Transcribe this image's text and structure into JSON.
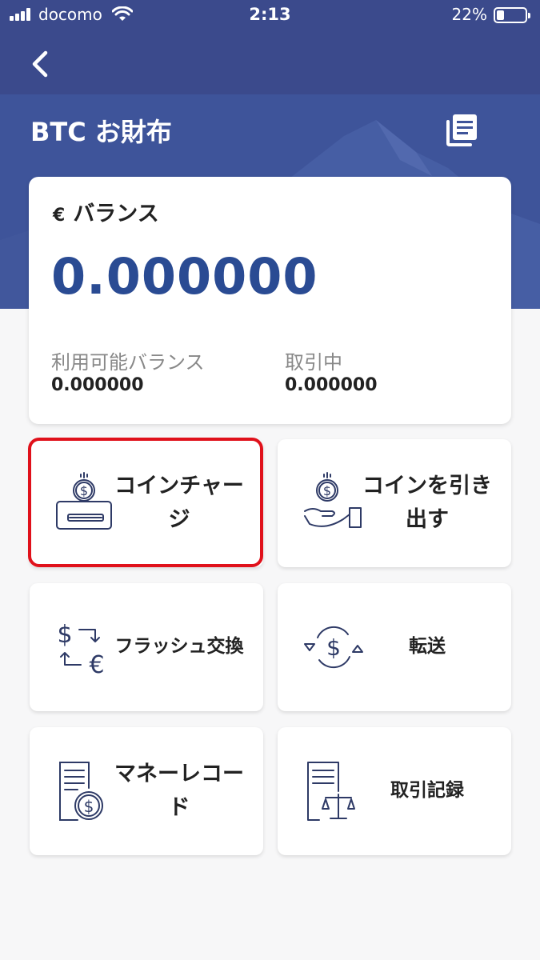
{
  "status_bar": {
    "carrier": "docomo",
    "time": "2:13",
    "battery": "22%",
    "battery_level": 0.22
  },
  "header": {
    "back_icon": "chevron-left-icon",
    "title": "BTC お財布",
    "records_icon": "document-list-icon",
    "background_color": "#3a4d8f"
  },
  "balance": {
    "currency_symbol": "€",
    "label": "バランス",
    "value": "0.000000",
    "available_label": "利用可能バランス",
    "available_value": "0.000000",
    "trading_label": "取引中",
    "trading_value": "0.000000",
    "value_color": "#2a4b93"
  },
  "actions": [
    {
      "label": "コインチャージ",
      "icon": "coin-charge-icon",
      "highlighted": true
    },
    {
      "label": "コインを引き出す",
      "icon": "coin-withdraw-icon",
      "highlighted": false
    },
    {
      "label": "フラッシュ交換",
      "icon": "flash-exchange-icon",
      "highlighted": false
    },
    {
      "label": "転送",
      "icon": "transfer-icon",
      "highlighted": false
    },
    {
      "label": "マネーレコード",
      "icon": "money-record-icon",
      "highlighted": false
    },
    {
      "label": "取引記録",
      "icon": "transaction-record-icon",
      "highlighted": false
    }
  ],
  "highlight_color": "#e0111b",
  "icon_color": "#2e3a66"
}
